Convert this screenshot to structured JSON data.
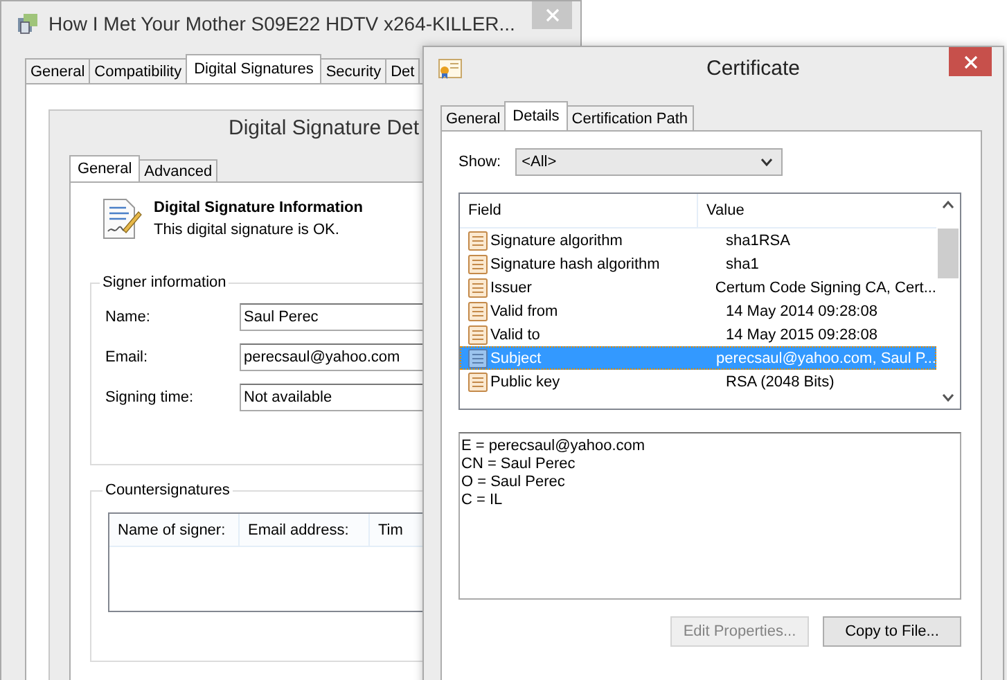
{
  "back_window": {
    "title": "How I Met Your Mother S09E22 HDTV x264-KILLER...",
    "tabs": [
      {
        "label": "General",
        "selected": false
      },
      {
        "label": "Compatibility",
        "selected": false
      },
      {
        "label": "Digital Signatures",
        "selected": true
      },
      {
        "label": "Security",
        "selected": false
      },
      {
        "label": "Det",
        "selected": false
      }
    ]
  },
  "signature_details": {
    "title": "Digital Signature Det",
    "tabs": [
      {
        "label": "General",
        "selected": true
      },
      {
        "label": "Advanced",
        "selected": false
      }
    ],
    "info_title": "Digital Signature Information",
    "info_text": "This digital signature is OK.",
    "signer_group": "Signer information",
    "signer_fields": [
      {
        "label": "Name:",
        "value": "Saul Perec"
      },
      {
        "label": "Email:",
        "value": "perecsaul@yahoo.com"
      },
      {
        "label": "Signing time:",
        "value": "Not available"
      }
    ],
    "countersignatures": {
      "title": "Countersignatures",
      "columns": [
        "Name of signer:",
        "Email address:",
        "Tim"
      ]
    }
  },
  "certificate": {
    "title": "Certificate",
    "tabs": [
      {
        "label": "General",
        "selected": false
      },
      {
        "label": "Details",
        "selected": true
      },
      {
        "label": "Certification Path",
        "selected": false
      }
    ],
    "show_label": "Show:",
    "show_value": "<All>",
    "columns": [
      "Field",
      "Value"
    ],
    "rows": [
      {
        "kind": "property",
        "field": "Signature algorithm",
        "value": "sha1RSA",
        "selected": false
      },
      {
        "kind": "property",
        "field": "Signature hash algorithm",
        "value": "sha1",
        "selected": false
      },
      {
        "kind": "property",
        "field": "Issuer",
        "value": "Certum Code Signing CA, Cert...",
        "selected": false
      },
      {
        "kind": "property",
        "field": "Valid from",
        "value": "14 May 2014 09:28:08",
        "selected": false
      },
      {
        "kind": "property",
        "field": "Valid to",
        "value": "14 May 2015 09:28:08",
        "selected": false
      },
      {
        "kind": "property",
        "field": "Subject",
        "value": "perecsaul@yahoo.com, Saul P...",
        "selected": true
      },
      {
        "kind": "property",
        "field": "Public key",
        "value": "RSA (2048 Bits)",
        "selected": false
      }
    ],
    "detail_lines": [
      "E = perecsaul@yahoo.com",
      "CN = Saul Perec",
      "O = Saul Perec",
      "C = IL"
    ],
    "buttons": [
      {
        "label": "Edit Properties...",
        "disabled": true
      },
      {
        "label": "Copy to File...",
        "disabled": false
      }
    ]
  }
}
